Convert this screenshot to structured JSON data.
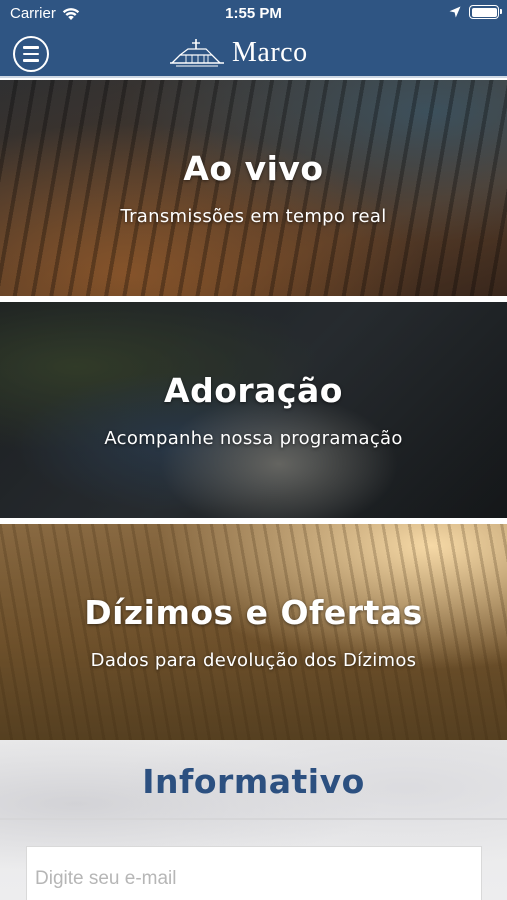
{
  "status_bar": {
    "carrier": "Carrier",
    "time": "1:55 PM",
    "icons": [
      "wifi-icon",
      "location-arrow-icon",
      "battery-icon"
    ]
  },
  "nav": {
    "logo_text": "Marco",
    "menu_icon": "hamburger-menu-icon",
    "bar_color": "#2f5583"
  },
  "cards": [
    {
      "title": "Ao vivo",
      "subtitle": "Transmissões em tempo real"
    },
    {
      "title": "Adoração",
      "subtitle": "Acompanhe nossa programação"
    },
    {
      "title": "Dízimos e Ofertas",
      "subtitle": "Dados para devolução dos Dízimos"
    }
  ],
  "newsletter": {
    "title": "Informativo",
    "email_placeholder": "Digite seu e-mail",
    "title_color": "#2c5080"
  }
}
